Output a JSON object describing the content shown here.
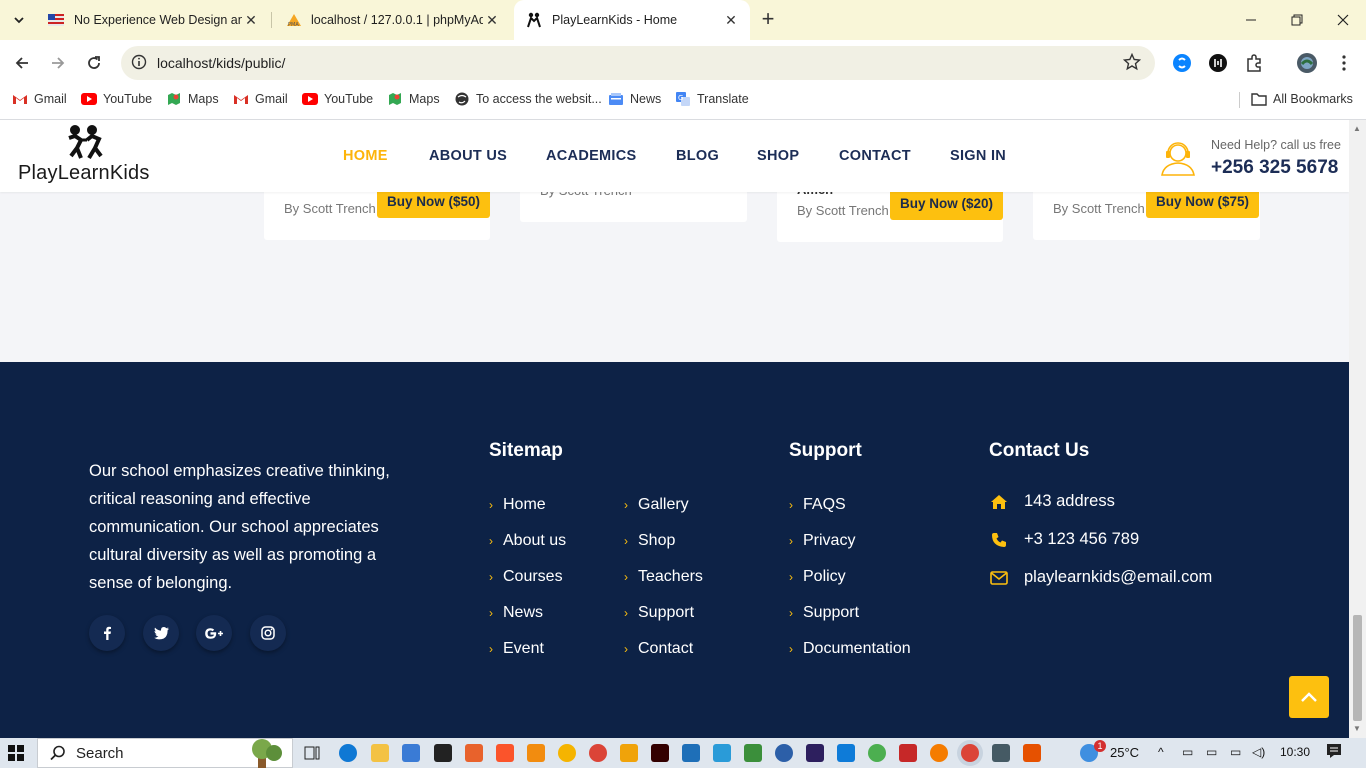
{
  "browser": {
    "tabs": [
      {
        "title": "No Experience Web Design and",
        "active": false
      },
      {
        "title": "localhost / 127.0.0.1 | phpMyAd",
        "active": false
      },
      {
        "title": "PlayLearnKids - Home",
        "active": true
      }
    ],
    "url": "localhost/kids/public/",
    "bookmarks": [
      "Gmail",
      "YouTube",
      "Maps",
      "Gmail",
      "YouTube",
      "Maps",
      "To access the websit...",
      "News",
      "Translate"
    ],
    "all_bookmarks": "All Bookmarks"
  },
  "site": {
    "logo_text": "PlayLearnKids",
    "nav": [
      "HOME",
      "ABOUT US",
      "ACADEMICS",
      "BLOG",
      "SHOP",
      "CONTACT",
      "SIGN IN"
    ],
    "help_label": "Need Help? call us free",
    "help_phone": "+256 325 5678",
    "accent": "#fdc00f",
    "navy": "#0d2246"
  },
  "products": {
    "cards": [
      {
        "by": "By Scott Trench",
        "buy": "Buy Now ($50)"
      },
      {
        "by": "By Scott Trench",
        "buy": ""
      },
      {
        "title_fragment": "Amen",
        "by": "By Scott Trench",
        "buy": "Buy Now ($20)"
      },
      {
        "by": "By Scott Trench",
        "buy": "Buy Now ($75)"
      }
    ]
  },
  "footer": {
    "about": "Our school emphasizes creative thinking, critical reasoning and effective communication. Our school appreciates cultural diversity as well as promoting a sense of belonging.",
    "social": [
      "facebook-icon",
      "twitter-icon",
      "google-plus-icon",
      "instagram-icon"
    ],
    "sitemap_title": "Sitemap",
    "sitemap_col1": [
      "Home",
      "About us",
      "Courses",
      "News",
      "Event"
    ],
    "sitemap_col2": [
      "Gallery",
      "Shop",
      "Teachers",
      "Support",
      "Contact"
    ],
    "support_title": "Support",
    "support_links": [
      "FAQS",
      "Privacy",
      "Policy",
      "Support",
      "Documentation"
    ],
    "contact_title": "Contact Us",
    "address": "143 address",
    "phone": "+3 123 456 789",
    "email": "playlearnkids@email.com"
  },
  "taskbar": {
    "search": "Search",
    "temperature": "25°C",
    "time": "10:30",
    "weather_badge": "1"
  }
}
